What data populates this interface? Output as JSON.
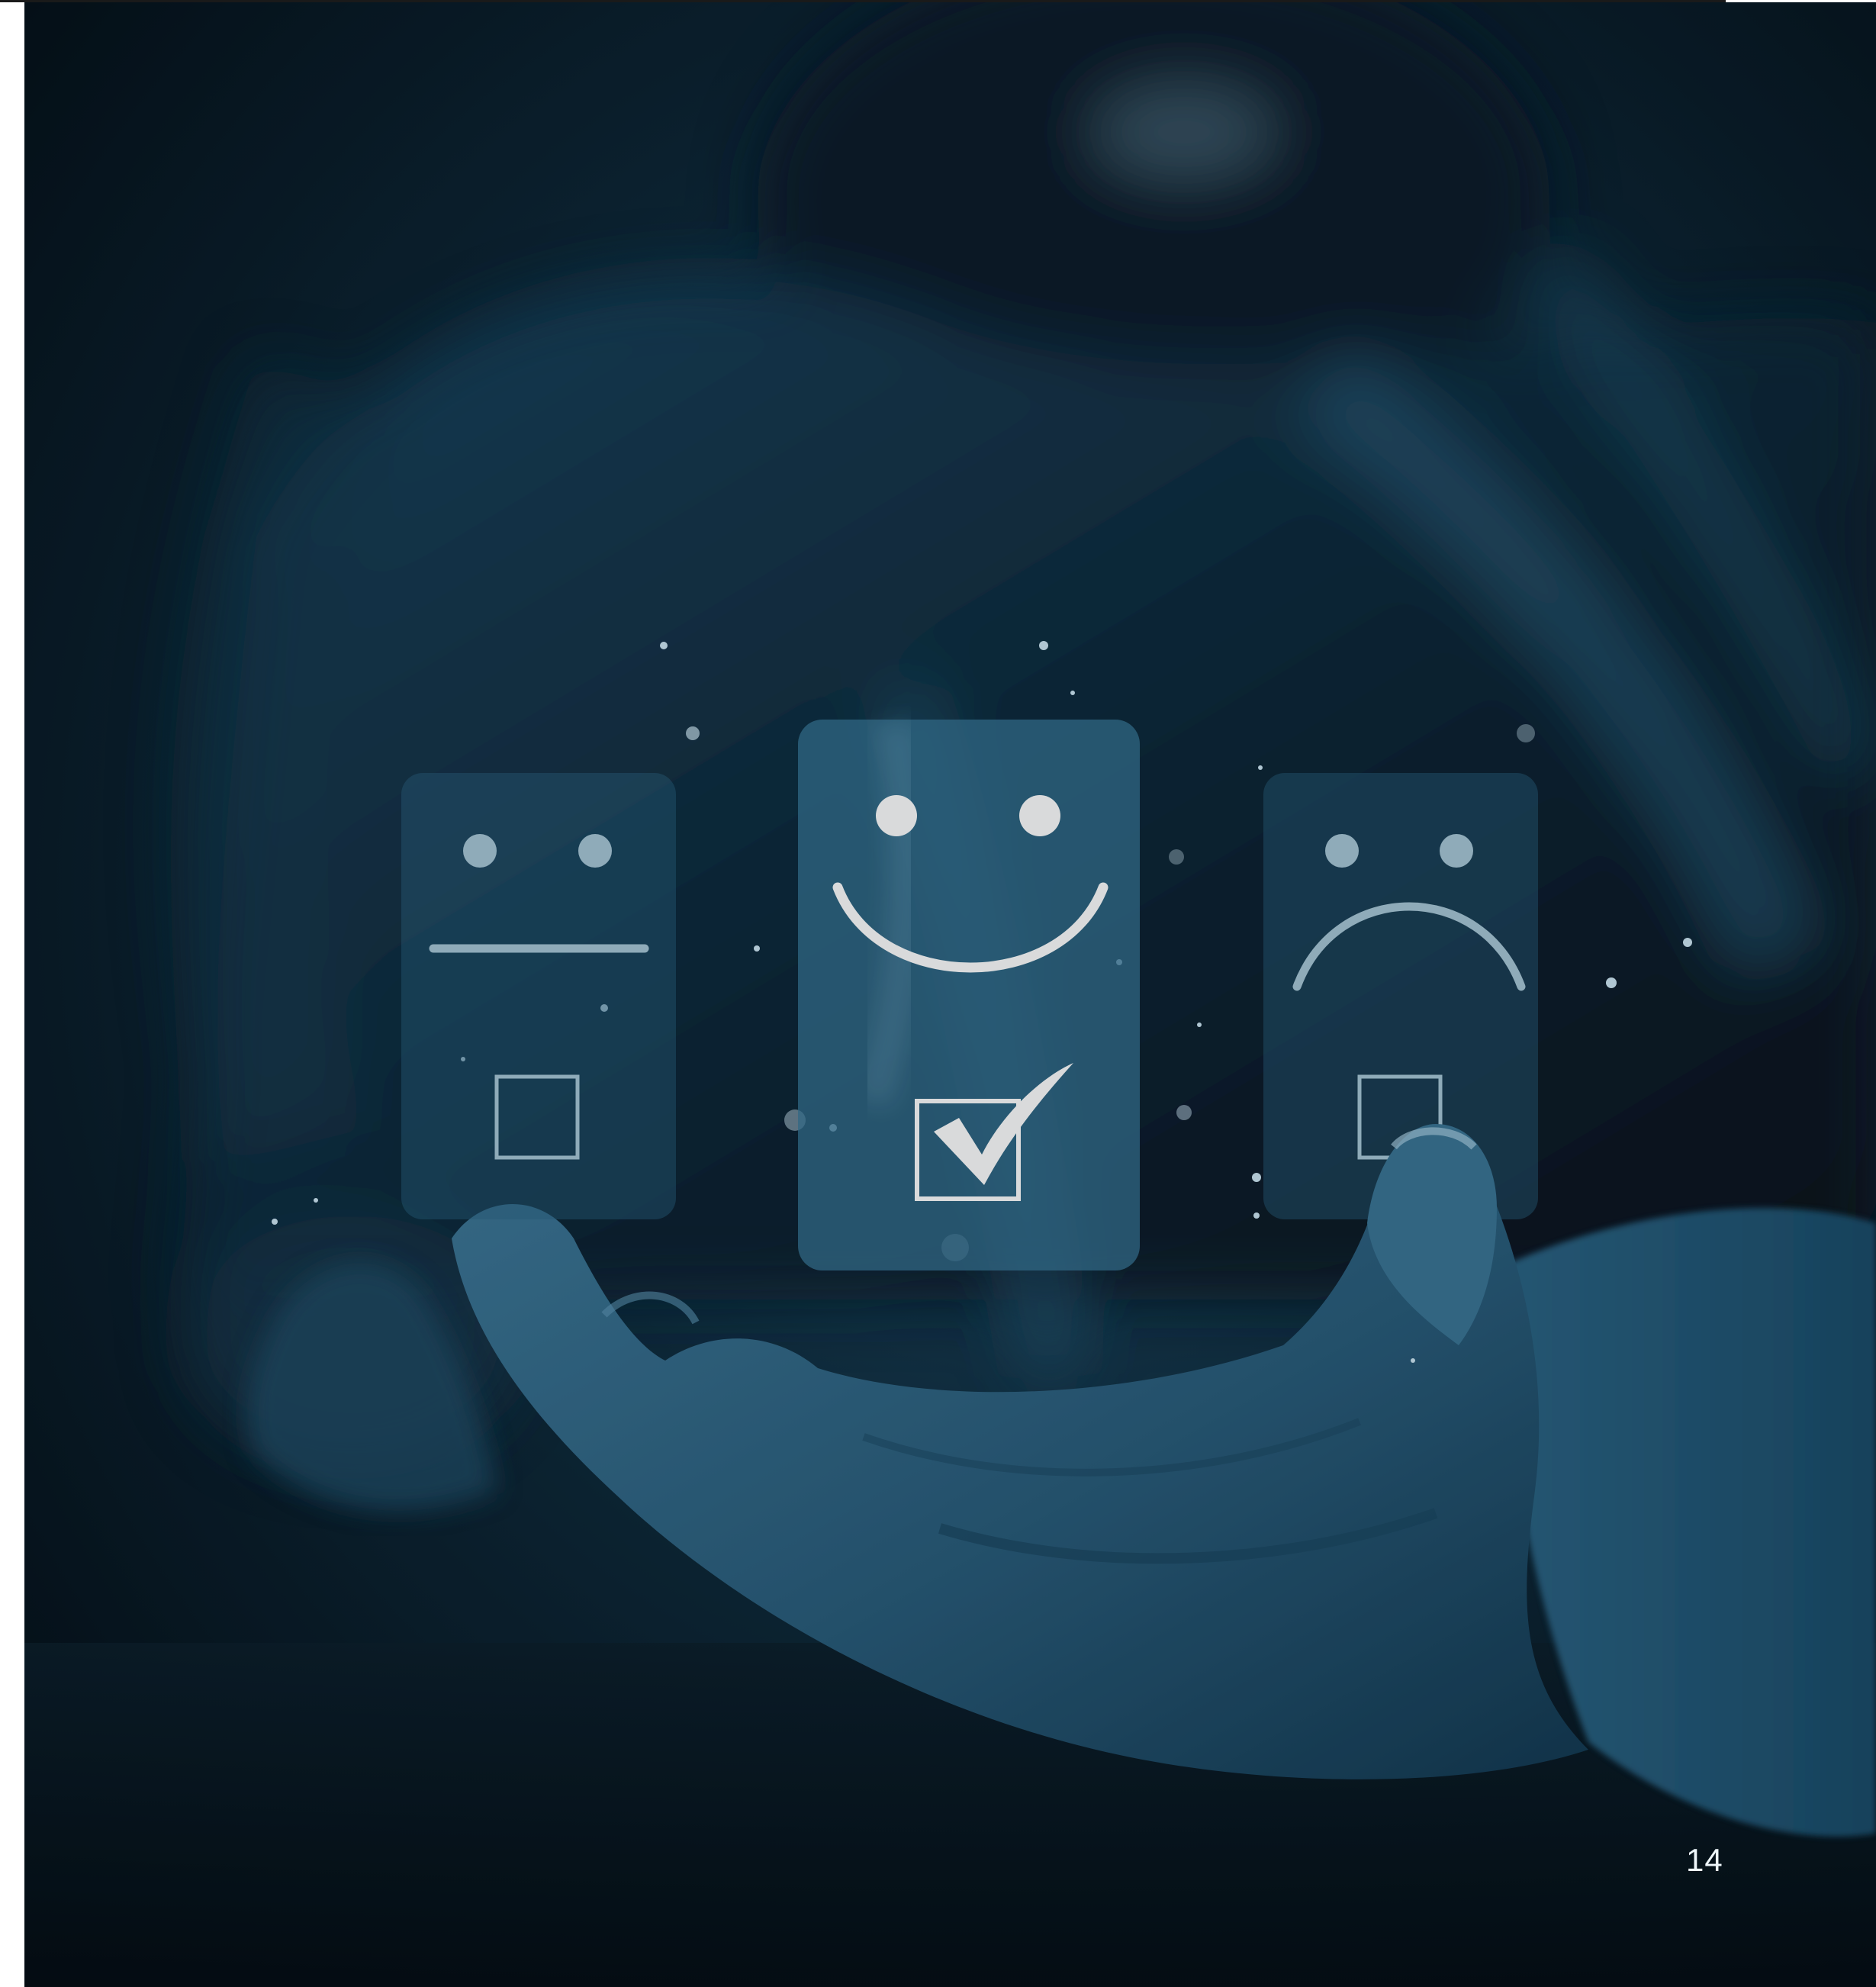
{
  "page": {
    "number": "14"
  },
  "photo": {
    "palette": {
      "dark": "#07161f",
      "mid": "#1c4a66",
      "light": "#4f8fb0",
      "card": "#2d6787",
      "glyph": "#ffffff"
    },
    "rating_cards": [
      {
        "face": "neutral-face-icon",
        "checked": false
      },
      {
        "face": "smiling-face-icon",
        "checked": true
      },
      {
        "face": "sad-face-icon",
        "checked": false
      }
    ]
  }
}
